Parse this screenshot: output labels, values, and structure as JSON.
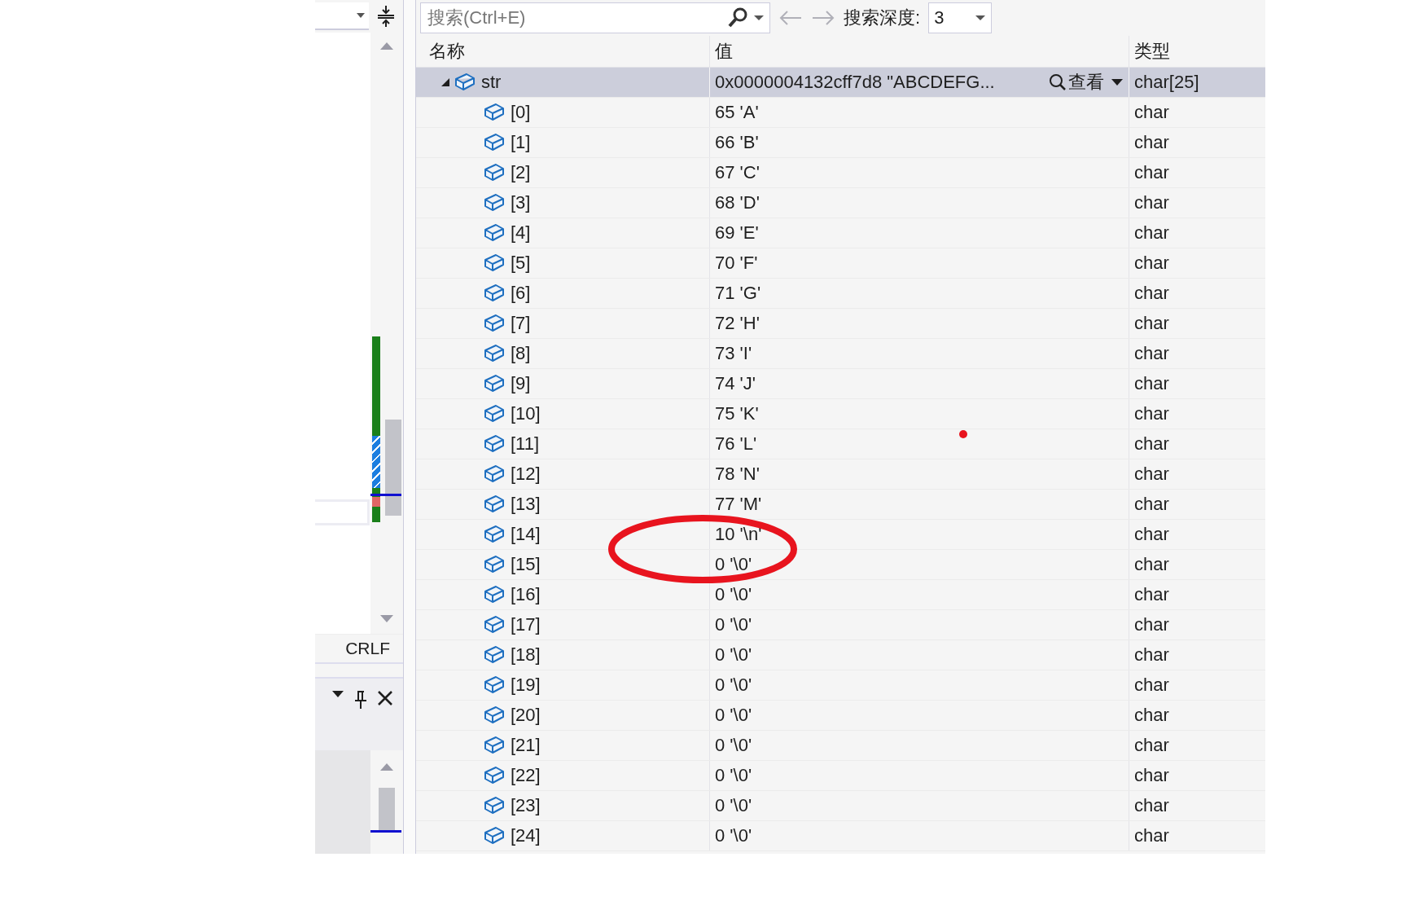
{
  "editor_strip": {
    "line_ending": "CRLF"
  },
  "toolbar": {
    "search": {
      "placeholder": "搜索(Ctrl+E)"
    },
    "depth_label": "搜索深度:",
    "depth_value": "3"
  },
  "columns": [
    "名称",
    "值",
    "类型"
  ],
  "rows": [
    {
      "name": "str",
      "value": "0x0000004132cff7d8 \"ABCDEFG...",
      "view_button": "查看",
      "type": "char[25]",
      "selected": true,
      "expanded": true,
      "children": [
        {
          "name": "[0]",
          "value": "65 'A'",
          "type": "char",
          "selected": false
        },
        {
          "name": "[1]",
          "value": "66 'B'",
          "type": "char",
          "selected": false
        },
        {
          "name": "[2]",
          "value": "67 'C'",
          "type": "char",
          "selected": false
        },
        {
          "name": "[3]",
          "value": "68 'D'",
          "type": "char",
          "selected": false
        },
        {
          "name": "[4]",
          "value": "69 'E'",
          "type": "char",
          "selected": false
        },
        {
          "name": "[5]",
          "value": "70 'F'",
          "type": "char",
          "selected": false
        },
        {
          "name": "[6]",
          "value": "71 'G'",
          "type": "char",
          "selected": false
        },
        {
          "name": "[7]",
          "value": "72 'H'",
          "type": "char",
          "selected": false
        },
        {
          "name": "[8]",
          "value": "73 'I'",
          "type": "char",
          "selected": false
        },
        {
          "name": "[9]",
          "value": "74 'J'",
          "type": "char",
          "selected": false
        },
        {
          "name": "[10]",
          "value": "75 'K'",
          "type": "char",
          "selected": false
        },
        {
          "name": "[11]",
          "value": "76 'L'",
          "type": "char",
          "selected": false
        },
        {
          "name": "[12]",
          "value": "78 'N'",
          "type": "char",
          "selected": false
        },
        {
          "name": "[13]",
          "value": "77 'M'",
          "type": "char",
          "selected": false
        },
        {
          "name": "[14]",
          "value": "10 '\\n'",
          "type": "char",
          "selected": false
        },
        {
          "name": "[15]",
          "value": "0 '\\0'",
          "type": "char",
          "selected": false
        },
        {
          "name": "[16]",
          "value": "0 '\\0'",
          "type": "char",
          "selected": false
        },
        {
          "name": "[17]",
          "value": "0 '\\0'",
          "type": "char",
          "selected": false
        },
        {
          "name": "[18]",
          "value": "0 '\\0'",
          "type": "char",
          "selected": false
        },
        {
          "name": "[19]",
          "value": "0 '\\0'",
          "type": "char",
          "selected": false
        },
        {
          "name": "[20]",
          "value": "0 '\\0'",
          "type": "char",
          "selected": false
        },
        {
          "name": "[21]",
          "value": "0 '\\0'",
          "type": "char",
          "selected": false
        },
        {
          "name": "[22]",
          "value": "0 '\\0'",
          "type": "char",
          "selected": false
        },
        {
          "name": "[23]",
          "value": "0 '\\0'",
          "type": "char",
          "selected": false
        },
        {
          "name": "[24]",
          "value": "0 '\\0'",
          "type": "char",
          "selected": false
        }
      ]
    }
  ]
}
